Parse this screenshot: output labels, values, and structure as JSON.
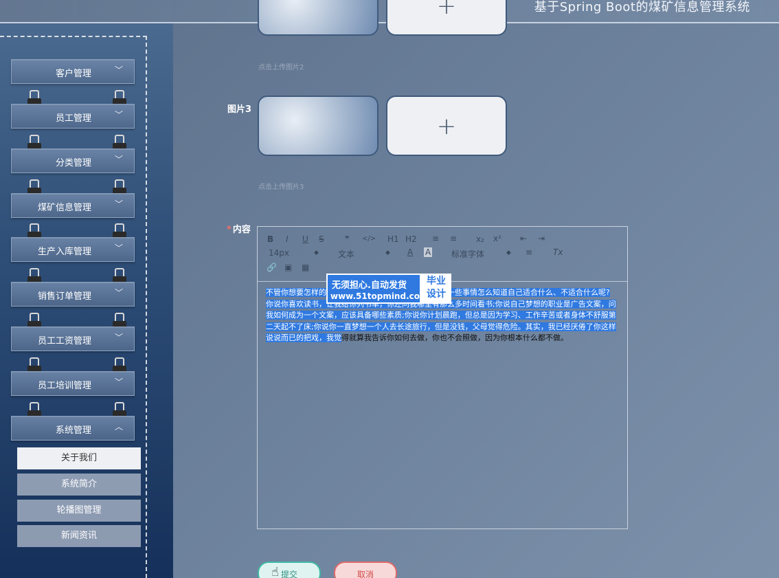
{
  "header": {
    "title": "基于Spring Boot的煤矿信息管理系统"
  },
  "sidebar": {
    "items": [
      {
        "label": "客户管理",
        "chevron": "﹀"
      },
      {
        "label": "员工管理",
        "chevron": "﹀"
      },
      {
        "label": "分类管理",
        "chevron": "﹀"
      },
      {
        "label": "煤矿信息管理",
        "chevron": "﹀"
      },
      {
        "label": "生产入库管理",
        "chevron": "﹀"
      },
      {
        "label": "销售订单管理",
        "chevron": "﹀"
      },
      {
        "label": "员工工资管理",
        "chevron": "﹀"
      },
      {
        "label": "员工培训管理",
        "chevron": "﹀"
      },
      {
        "label": "系统管理",
        "chevron": "︿"
      }
    ],
    "sub_items": [
      {
        "label": "关于我们",
        "active": true
      },
      {
        "label": "系统简介",
        "active": false
      },
      {
        "label": "轮播图管理",
        "active": false
      },
      {
        "label": "新闻资讯",
        "active": false
      }
    ]
  },
  "form": {
    "image2_hint": "点击上传图片2",
    "image3_label": "图片3",
    "image3_hint": "点击上传图片3",
    "content_label": "内容",
    "content_required": "*",
    "add_symbol": "+"
  },
  "editor": {
    "toolbar": {
      "bold": "B",
      "italic": "I",
      "underline": "U",
      "strike": "S",
      "quote": "❞",
      "code": "</>",
      "h1": "H1",
      "h2": "H2",
      "ordered": "≡",
      "bullet": "≡",
      "sub": "x₂",
      "sup": "x²",
      "outdent": "⇤",
      "indent": "⇥",
      "font_size": "14px",
      "text_style": "文本",
      "font_family": "标准字体",
      "color": "A",
      "bg_color": "A",
      "align": "≡",
      "clear": "Tx",
      "link": "🔗",
      "image": "▣",
      "video": "▦"
    },
    "content_selected": "不管你想要怎样的生活，你都要去努力争取，不多尝试一些事情怎么知道自己适合什么、不适合什么呢? 你说你喜欢读书，让我给你列书单，你还问我哪里有那么多时间看书;你说自己梦想的职业是广告文案，问我如何成为一个文案，应该具备哪些素质;你说你计划晨跑，但总是因为学习、工作辛苦或者身体不舒服第二天起不了床;你说你一直梦想一个人去长途旅行，但是没钱，父母觉得危险。其实，我已经厌倦了你这样说说而已的把戏，我觉",
    "content_rest": "得就算我告诉你如何去做，你也不会照做，因为你根本什么都不做。"
  },
  "watermark": {
    "line1": "无须担心.自动发货",
    "line2": "www.51topmind.com",
    "right": "毕业设计"
  },
  "buttons": {
    "submit": "提交",
    "cancel": "取消"
  }
}
